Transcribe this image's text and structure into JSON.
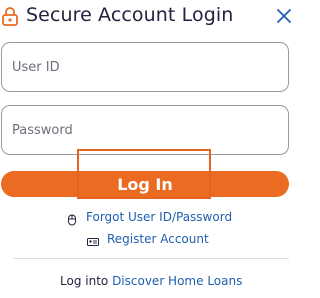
{
  "header": {
    "title": "Secure Account Login",
    "lock_icon": "lock-icon",
    "close_icon": "close-icon"
  },
  "form": {
    "user_id_placeholder": "User ID",
    "user_id_value": "",
    "password_placeholder": "Password",
    "password_value": "",
    "login_label": "Log In"
  },
  "links": {
    "forgot_label": "Forgot User ID/Password",
    "forgot_icon": "mouse-icon",
    "register_label": "Register Account",
    "register_icon": "id-card-icon"
  },
  "footer": {
    "prefix": "Log into",
    "link_label": "Discover Home Loans"
  },
  "colors": {
    "accent": "#ec6b22",
    "link": "#1f5fad",
    "text": "#23233f",
    "highlight": "#e4641f"
  }
}
